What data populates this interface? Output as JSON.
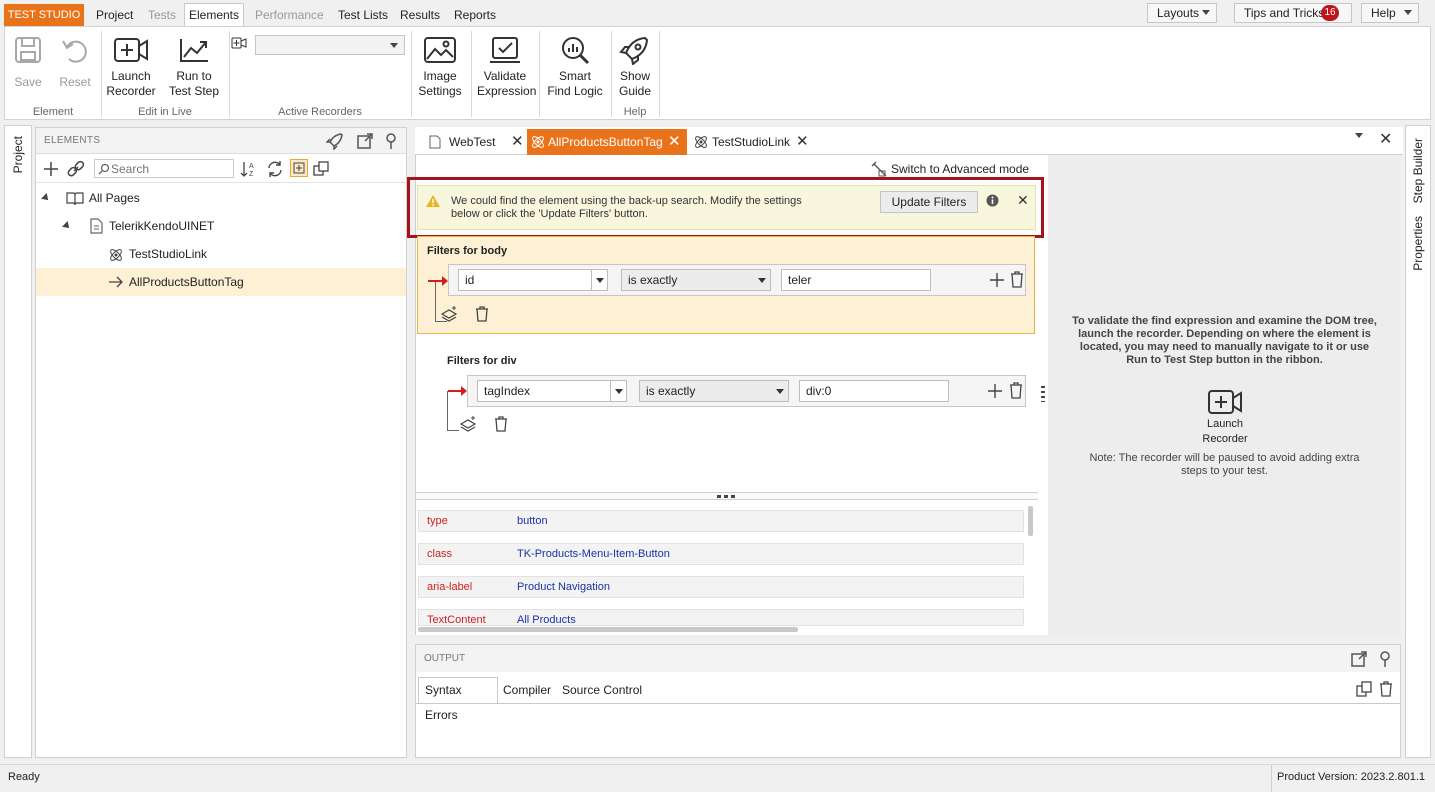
{
  "app": {
    "brand": "TEST STUDIO"
  },
  "menu_tabs": {
    "project": "Project",
    "tests": "Tests",
    "elements": "Elements",
    "performance": "Performance",
    "test_lists": "Test Lists",
    "results": "Results",
    "reports": "Reports"
  },
  "topright": {
    "layouts": "Layouts",
    "tips": "Tips and Tricks",
    "tips_count": "16",
    "help": "Help"
  },
  "ribbon": {
    "save": "Save",
    "reset": "Reset",
    "group_element": "Element",
    "launch_recorder_1": "Launch",
    "launch_recorder_2": "Recorder",
    "run_to_1": "Run to",
    "run_to_2": "Test Step",
    "group_edit_live": "Edit in Live",
    "group_active_recorders": "Active Recorders",
    "image_settings_1": "Image",
    "image_settings_2": "Settings",
    "validate_1": "Validate",
    "validate_2": "Expression",
    "smart_1": "Smart",
    "smart_2": "Find Logic",
    "guide_1": "Show",
    "guide_2": "Guide",
    "group_help": "Help"
  },
  "side": {
    "project": "Project",
    "step_builder": "Step Builder",
    "properties": "Properties"
  },
  "elements_panel": {
    "title": "ELEMENTS",
    "search_placeholder": "Search",
    "tree": [
      "All Pages",
      "TelerikKendoUINET",
      "TestStudioLink",
      "AllProductsButtonTag"
    ]
  },
  "doc_tabs": [
    "WebTest",
    "AllProductsButtonTag",
    "TestStudioLink"
  ],
  "editor": {
    "advanced_mode": "Switch to Advanced mode",
    "warning_line1": "We could find the element using the back-up search. Modify the settings",
    "warning_line2": "below or click the 'Update Filters' button.",
    "update_filters": "Update Filters",
    "filters_body": "Filters for body",
    "filters_div": "Filters for div",
    "body_filter": {
      "attribute": "id",
      "operator": "is exactly",
      "value": "teler"
    },
    "div_filter": {
      "attribute": "tagIndex",
      "operator": "is exactly",
      "value": "div:0"
    }
  },
  "attributes": [
    {
      "key": "type",
      "value": "button"
    },
    {
      "key": "class",
      "value": "TK-Products-Menu-Item-Button"
    },
    {
      "key": "aria-label",
      "value": "Product Navigation"
    },
    {
      "key": "TextContent",
      "value": "All Products"
    }
  ],
  "info": {
    "line1": "To validate the find expression and examine the DOM tree,",
    "line2": "launch the recorder. Depending on where the element is",
    "line3": "located, you may need to manually navigate to it or use",
    "line4": "Run to Test Step button in the ribbon.",
    "launch_1": "Launch",
    "launch_2": "Recorder",
    "note1": "Note: The recorder will be paused to avoid adding extra",
    "note2": "steps to your test."
  },
  "output": {
    "title": "OUTPUT",
    "tabs": [
      "Syntax Errors",
      "Compiler",
      "Source Control"
    ]
  },
  "status": {
    "left": "Ready",
    "version": "Product Version: 2023.2.801.1"
  },
  "colors": {
    "accent": "#e8731a",
    "warning_border": "#a3141b",
    "attr_key": "#c22222",
    "attr_value": "#1a32a8"
  }
}
